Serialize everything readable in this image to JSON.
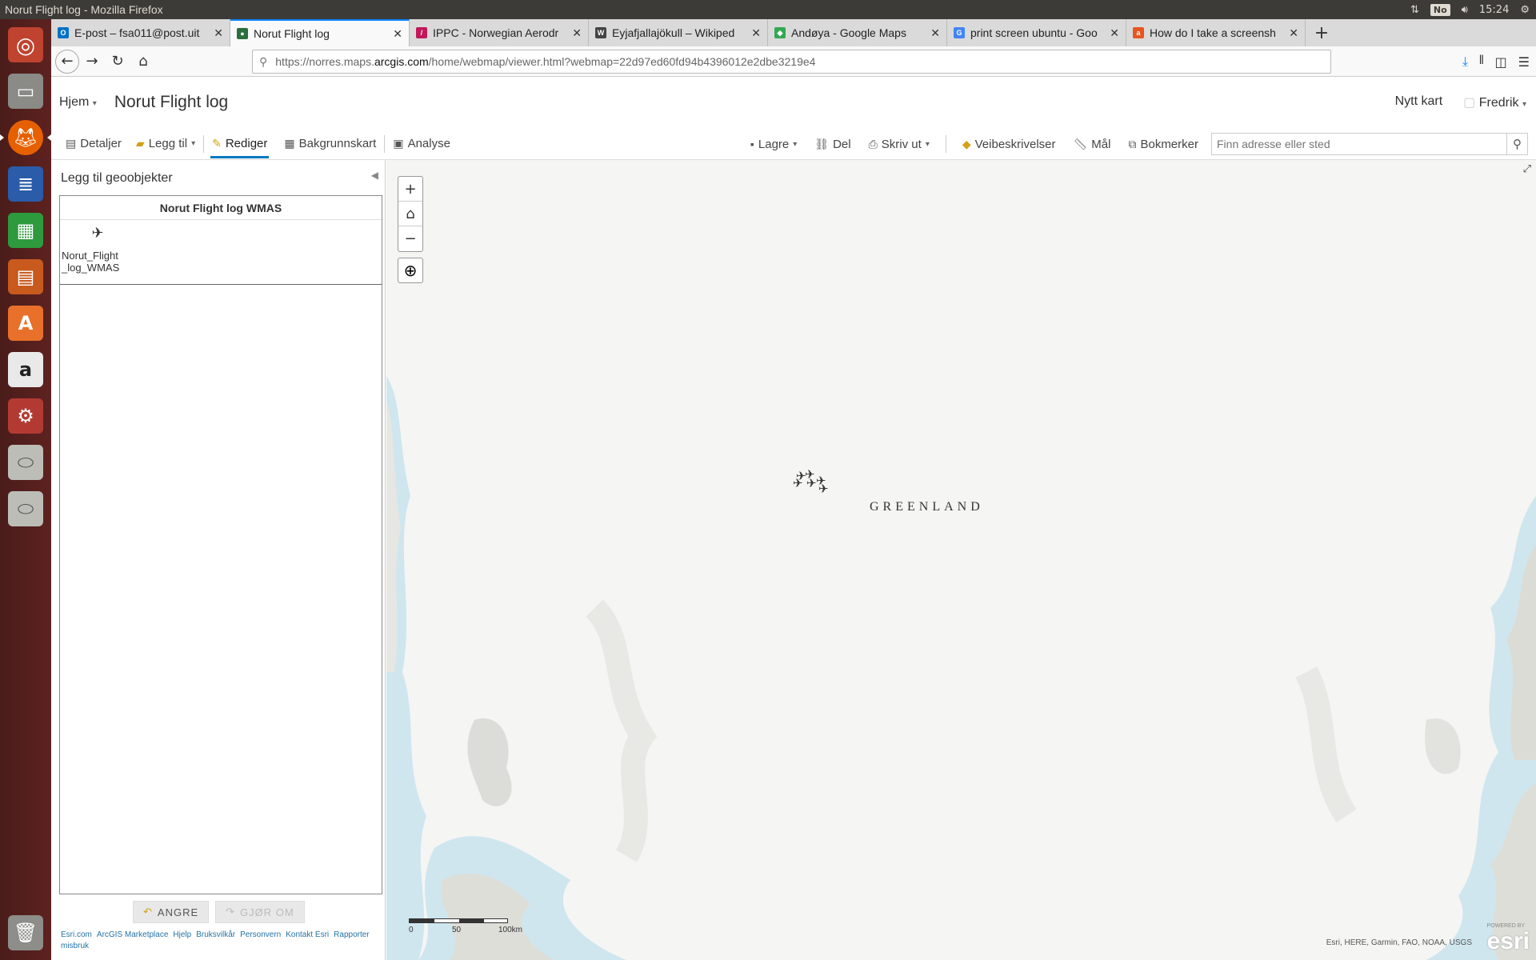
{
  "window": {
    "title": "Norut Flight log - Mozilla Firefox"
  },
  "system": {
    "keyboard": "No",
    "time": "15:24"
  },
  "tabs": [
    {
      "label": "E-post – fsa011@post.uit",
      "fav": "outlook-icon",
      "color": "#0072c6",
      "glyph": "O"
    },
    {
      "label": "Norut Flight log",
      "fav": "arcgis-globe-icon",
      "color": "#2a6f3c",
      "glyph": "●"
    },
    {
      "label": "IPPC - Norwegian Aerodr",
      "fav": "ippc-icon",
      "color": "#c2185b",
      "glyph": "/"
    },
    {
      "label": "Eyjafjallajökull – Wikiped",
      "fav": "wikipedia-icon",
      "color": "#444",
      "glyph": "W"
    },
    {
      "label": "Andøya - Google Maps",
      "fav": "google-maps-icon",
      "color": "#34a853",
      "glyph": "◆"
    },
    {
      "label": "print screen ubuntu - Goo",
      "fav": "google-icon",
      "color": "#4285f4",
      "glyph": "G"
    },
    {
      "label": "How do I take a screensh",
      "fav": "askubuntu-icon",
      "color": "#e95420",
      "glyph": "a"
    }
  ],
  "url": {
    "prefix": "https://norres.maps.",
    "domain": "arcgis.com",
    "path": "/home/webmap/viewer.html?webmap=22d97ed60fd94b4396012e2dbe3219e4"
  },
  "header": {
    "home": "Hjem",
    "title": "Norut Flight log",
    "new_map": "Nytt kart",
    "user": "Fredrik"
  },
  "toolbar": {
    "details": "Detaljer",
    "add": "Legg til",
    "edit": "Rediger",
    "basemap": "Bakgrunnskart",
    "analysis": "Analyse",
    "save": "Lagre",
    "share": "Del",
    "print": "Skriv ut",
    "directions": "Veibeskrivelser",
    "measure": "Mål",
    "bookmarks": "Bokmerker",
    "search_placeholder": "Finn adresse eller sted"
  },
  "panel": {
    "title": "Legg til geoobjekter",
    "template_group": "Norut Flight log WMAS",
    "template_item_line1": "Norut_Flight",
    "template_item_line2": "_log_WMAS",
    "undo": "ANGRE",
    "redo": "GJØR OM",
    "footer_links": [
      "Esri.com",
      "ArcGIS Marketplace",
      "Hjelp",
      "Bruksvilkår",
      "Personvern",
      "Kontakt Esri",
      "Rapporter misbruk"
    ]
  },
  "map": {
    "region_label": "GREENLAND",
    "scale_labels": [
      "0",
      "50",
      "100km"
    ],
    "attribution": "Esri, HERE, Garmin, FAO, NOAA, USGS",
    "brand": "esri",
    "brand_sub": "POWERED BY",
    "feature_count": 6
  }
}
